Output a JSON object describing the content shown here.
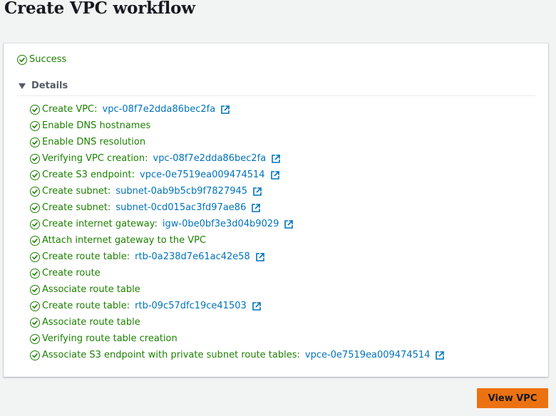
{
  "page": {
    "title": "Create VPC workflow"
  },
  "status": {
    "label": "Success"
  },
  "details": {
    "label": "Details",
    "steps": [
      {
        "text": "Create VPC:",
        "link": "vpc-08f7e2dda86bec2fa"
      },
      {
        "text": "Enable DNS hostnames",
        "link": null
      },
      {
        "text": "Enable DNS resolution",
        "link": null
      },
      {
        "text": "Verifying VPC creation:",
        "link": "vpc-08f7e2dda86bec2fa"
      },
      {
        "text": "Create S3 endpoint:",
        "link": "vpce-0e7519ea009474514"
      },
      {
        "text": "Create subnet:",
        "link": "subnet-0ab9b5cb9f7827945"
      },
      {
        "text": "Create subnet:",
        "link": "subnet-0cd015ac3fd97ae86"
      },
      {
        "text": "Create internet gateway:",
        "link": "igw-0be0bf3e3d04b9029"
      },
      {
        "text": "Attach internet gateway to the VPC",
        "link": null
      },
      {
        "text": "Create route table:",
        "link": "rtb-0a238d7e61ac42e58"
      },
      {
        "text": "Create route",
        "link": null
      },
      {
        "text": "Associate route table",
        "link": null
      },
      {
        "text": "Create route table:",
        "link": "rtb-09c57dfc19ce41503"
      },
      {
        "text": "Associate route table",
        "link": null
      },
      {
        "text": "Verifying route table creation",
        "link": null
      },
      {
        "text": "Associate S3 endpoint with private subnet route tables:",
        "link": "vpce-0e7519ea009474514"
      }
    ]
  },
  "actions": {
    "view_vpc": "View VPC"
  },
  "icons": {
    "status": "check-circle-icon",
    "link": "external-link-icon",
    "expand": "caret-down-icon"
  },
  "colors": {
    "success": "#1d8102",
    "link": "#0073bb",
    "primary_button": "#ec7211"
  }
}
